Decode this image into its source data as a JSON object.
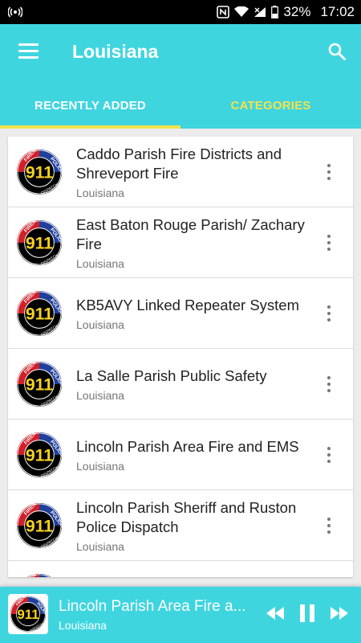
{
  "status_bar": {
    "battery": "32%",
    "time": "17:02"
  },
  "header": {
    "title": "Louisiana",
    "tabs": [
      {
        "label": "RECENTLY ADDED",
        "active": true
      },
      {
        "label": "CATEGORIES",
        "active": false
      }
    ]
  },
  "list": {
    "items": [
      {
        "title": "Caddo Parish Fire Districts and Shreveport Fire",
        "subtitle": "Louisiana"
      },
      {
        "title": "East Baton Rouge Parish/ Zachary Fire",
        "subtitle": "Louisiana"
      },
      {
        "title": "KB5AVY Linked Repeater System",
        "subtitle": "Louisiana"
      },
      {
        "title": "La Salle Parish Public Safety",
        "subtitle": "Louisiana"
      },
      {
        "title": "Lincoln Parish Area Fire and EMS",
        "subtitle": "Louisiana"
      },
      {
        "title": "Lincoln Parish Sheriff and Ruston Police Dispatch",
        "subtitle": "Louisiana"
      }
    ]
  },
  "player": {
    "title": "Lincoln Parish Area Fire a...",
    "subtitle": "Louisiana"
  },
  "logo": {
    "number": "911",
    "top_text": "FIRE/EMS",
    "right_text": "POLICE",
    "bottom_text": "DISPATCH"
  },
  "colors": {
    "primary": "#3fd5df",
    "accent": "#f4e24a",
    "logo_blue": "#1f3f9a",
    "logo_red": "#d0202a",
    "logo_gold": "#f7d21c"
  }
}
